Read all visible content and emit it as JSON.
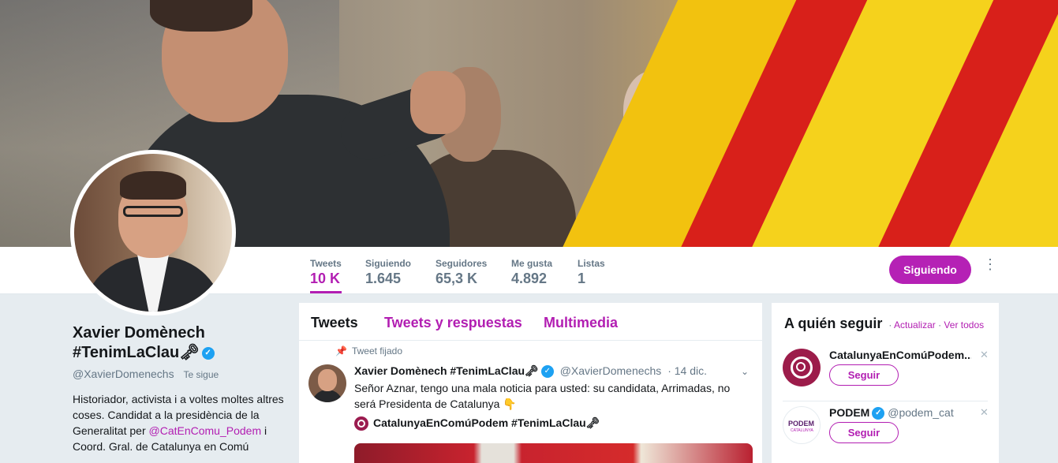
{
  "profile": {
    "name_line1": "Xavier Domènech",
    "name_line2": "#TenimLaClau🗝",
    "handle": "@XavierDomenechs",
    "follows_you": "Te sigue",
    "bio_text1": "Historiador, activista i a voltes moltes altres coses. Candidat a la presidència de la Generalitat per ",
    "bio_link": "@CatEnComu_Podem",
    "bio_text2": " i Coord. Gral. de Catalunya en Comú"
  },
  "stats": [
    {
      "label": "Tweets",
      "value": "10 K"
    },
    {
      "label": "Siguiendo",
      "value": "1.645"
    },
    {
      "label": "Seguidores",
      "value": "65,3 K"
    },
    {
      "label": "Me gusta",
      "value": "4.892"
    },
    {
      "label": "Listas",
      "value": "1"
    }
  ],
  "actions": {
    "following_label": "Siguiendo",
    "more_icon": "more-vertical-icon"
  },
  "timeline": {
    "tabs": [
      "Tweets",
      "Tweets y respuestas",
      "Multimedia"
    ],
    "pinned_label": "Tweet fijado",
    "tweet": {
      "name": "Xavier Domènech #TenimLaClau🗝",
      "handle": "@XavierDomenechs",
      "date": "· 14 dic.",
      "text": "Señor Aznar, tengo una mala noticia para usted: su candidata, Arrimadas, no será Presidenta de Catalunya 👇",
      "quote_name": "CatalunyaEnComúPodem #TenimLaClau🗝"
    }
  },
  "who_to_follow": {
    "title": "A quién seguir",
    "refresh": "Actualizar",
    "view_all": "Ver todos",
    "suggestions": [
      {
        "name": "CatalunyaEnComúPodem...",
        "handle": "",
        "button": "Seguir"
      },
      {
        "name": "PODEM",
        "handle": "@podem_cat",
        "button": "Seguir",
        "logo_text": "PODEM",
        "logo_sub": "CATALUNYA"
      }
    ]
  },
  "colors": {
    "accent": "#b21eb2",
    "verified": "#1da1f2",
    "background": "#e6ecf0"
  }
}
